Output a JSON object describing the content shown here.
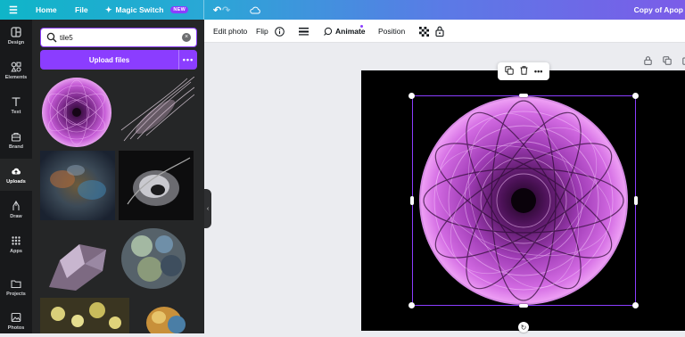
{
  "topbar": {
    "menu_icon": "hamburger-icon",
    "home": "Home",
    "file": "File",
    "magic_switch": "Magic Switch",
    "new_badge": "NEW",
    "undo_icon": "undo-icon",
    "redo_icon": "redo-icon",
    "cloud_icon": "cloud-icon",
    "doc_title": "Copy of Apop"
  },
  "rail": {
    "items": [
      {
        "label": "Design",
        "icon": "design-icon"
      },
      {
        "label": "Elements",
        "icon": "elements-icon"
      },
      {
        "label": "Text",
        "icon": "text-icon"
      },
      {
        "label": "Brand",
        "icon": "brand-icon"
      },
      {
        "label": "Uploads",
        "icon": "cloud-upload-icon"
      },
      {
        "label": "Draw",
        "icon": "pen-icon"
      },
      {
        "label": "Apps",
        "icon": "apps-grid-icon"
      },
      {
        "label": "Projects",
        "icon": "folder-icon"
      },
      {
        "label": "Photos",
        "icon": "photo-icon"
      }
    ],
    "active": "Uploads"
  },
  "panel": {
    "search_value": "tile5",
    "upload_label": "Upload files",
    "more_label": "•••"
  },
  "toolbar": {
    "edit_photo": "Edit photo",
    "flip": "Flip",
    "animate": "Animate",
    "position": "Position"
  },
  "colors": {
    "accent": "#8b3dff",
    "panel_bg": "#252627",
    "rail_bg": "#18191b",
    "canvas_bg": "#ebecf0"
  }
}
